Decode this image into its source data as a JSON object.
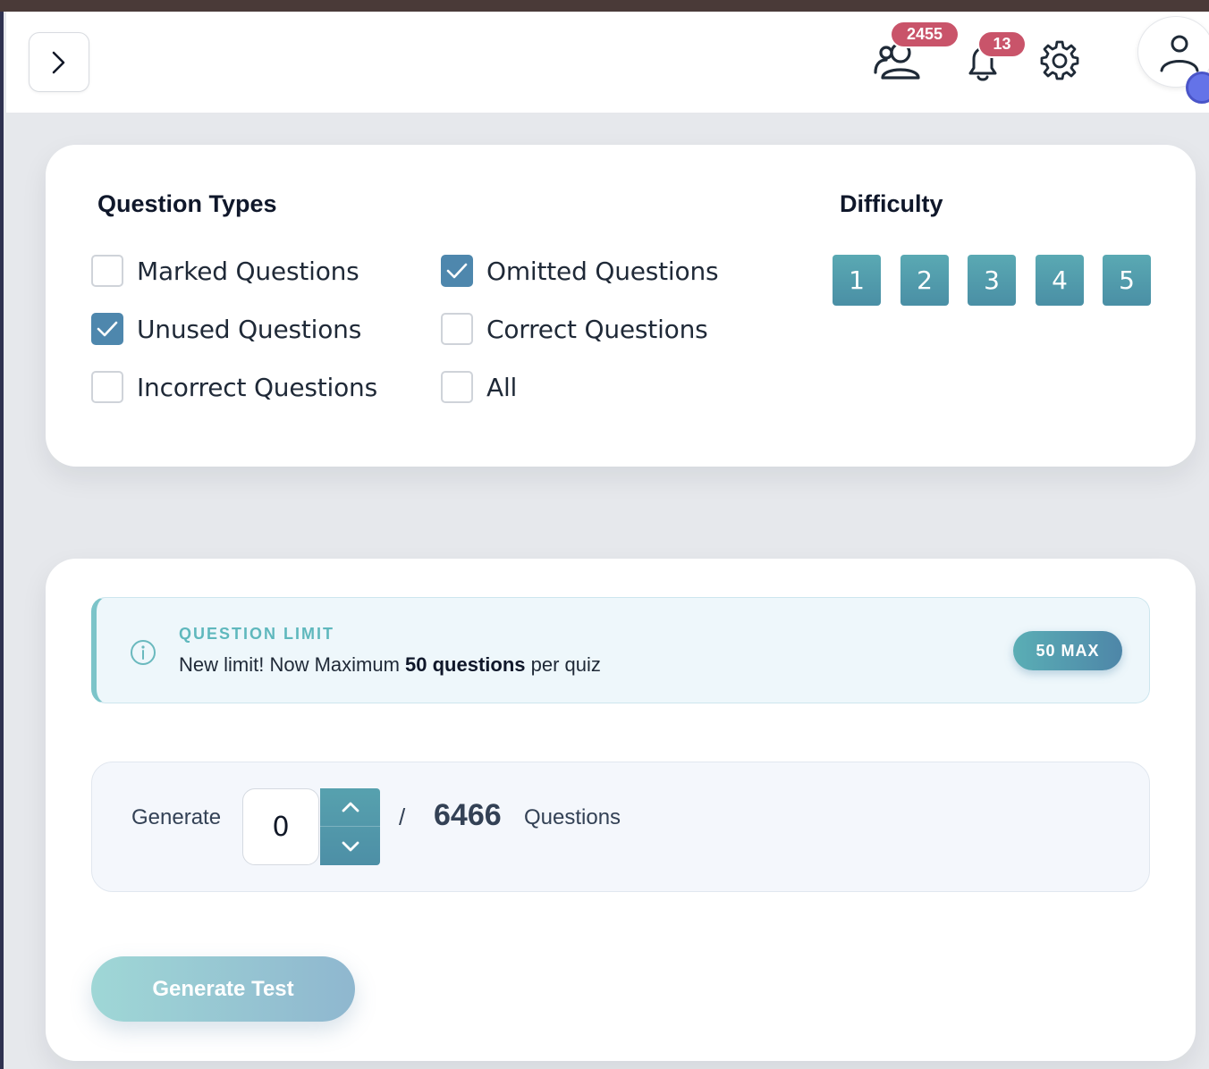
{
  "header": {
    "users_badge": "2455",
    "notifications_badge": "13"
  },
  "question_types": {
    "title": "Question Types",
    "options": [
      {
        "label": "Marked Questions",
        "checked": false
      },
      {
        "label": "Omitted Questions",
        "checked": true
      },
      {
        "label": "Unused Questions",
        "checked": true
      },
      {
        "label": "Correct Questions",
        "checked": false
      },
      {
        "label": "Incorrect Questions",
        "checked": false
      },
      {
        "label": "All",
        "checked": false
      }
    ]
  },
  "difficulty": {
    "title": "Difficulty",
    "levels": [
      "1",
      "2",
      "3",
      "4",
      "5"
    ]
  },
  "limit": {
    "title": "QUESTION LIMIT",
    "text_prefix": "New limit! Now Maximum ",
    "text_bold": "50 questions",
    "text_suffix": " per quiz",
    "pill": "50 MAX"
  },
  "generator": {
    "label": "Generate",
    "value": "0",
    "separator": "/",
    "total": "6466",
    "unit": "Questions"
  },
  "actions": {
    "generate_test": "Generate Test"
  },
  "colors": {
    "accent_teal": "#5aa9b3",
    "accent_blue": "#4e87ad",
    "badge_red": "#c9546a",
    "avatar_dot": "#6473e8"
  }
}
